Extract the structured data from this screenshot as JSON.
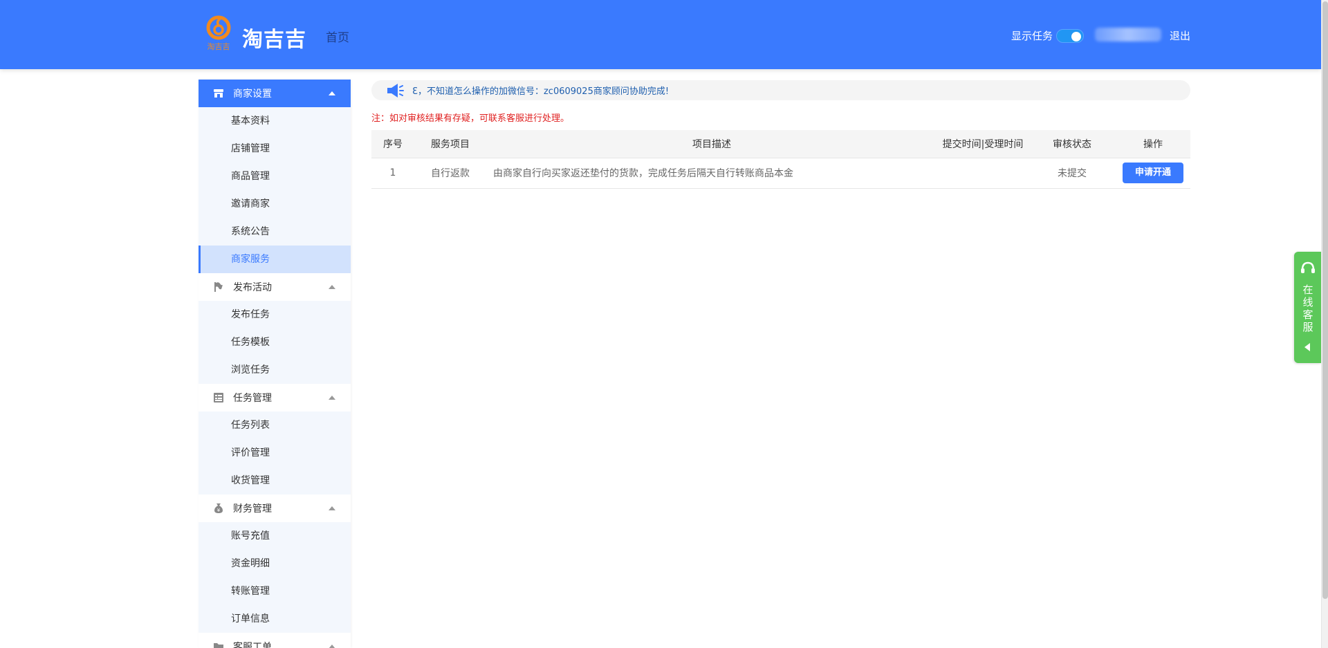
{
  "header": {
    "logo_text": "淘吉吉",
    "logo_mark_text": "淘吉吉",
    "nav_home": "首页",
    "task_toggle_label": "显示任务",
    "task_toggle_on": true,
    "logout": "退出"
  },
  "sidebar": {
    "groups": [
      {
        "label": "商家设置",
        "icon": "store-icon",
        "active": true,
        "items": [
          "基本资料",
          "店铺管理",
          "商品管理",
          "邀请商家",
          "系统公告",
          "商家服务"
        ]
      },
      {
        "label": "发布活动",
        "icon": "flag-icon",
        "items": [
          "发布任务",
          "任务模板",
          "浏览任务"
        ]
      },
      {
        "label": "任务管理",
        "icon": "list-icon",
        "items": [
          "任务列表",
          "评价管理",
          "收货管理"
        ]
      },
      {
        "label": "财务管理",
        "icon": "money-bag-icon",
        "items": [
          "账号充值",
          "资金明细",
          "转账管理",
          "订单信息"
        ]
      },
      {
        "label": "客服工单",
        "icon": "folder-icon",
        "items": []
      }
    ],
    "current_item": "商家服务"
  },
  "notice": {
    "text": "Ɛ，不知道怎么操作的加微信号：zc0609025商家顾问协助完成!",
    "icon": "speaker-icon"
  },
  "note": "注：如对审核结果有存疑，可联系客服进行处理。",
  "table": {
    "headers": [
      "序号",
      "服务项目",
      "项目描述",
      "提交时间|受理时间",
      "审核状态",
      "操作"
    ],
    "rows": [
      {
        "index": "1",
        "service": "自行返款",
        "description": "由商家自行向买家返还垫付的货款，完成任务后隔天自行转账商品本金",
        "times": "",
        "status": "未提交",
        "action": "申请开通"
      }
    ]
  },
  "cs_float": {
    "label": "在线客服",
    "icon": "headset-icon"
  },
  "colors": {
    "primary": "#3a7afe",
    "danger": "#e02020",
    "cs_green": "#5cc85a"
  }
}
